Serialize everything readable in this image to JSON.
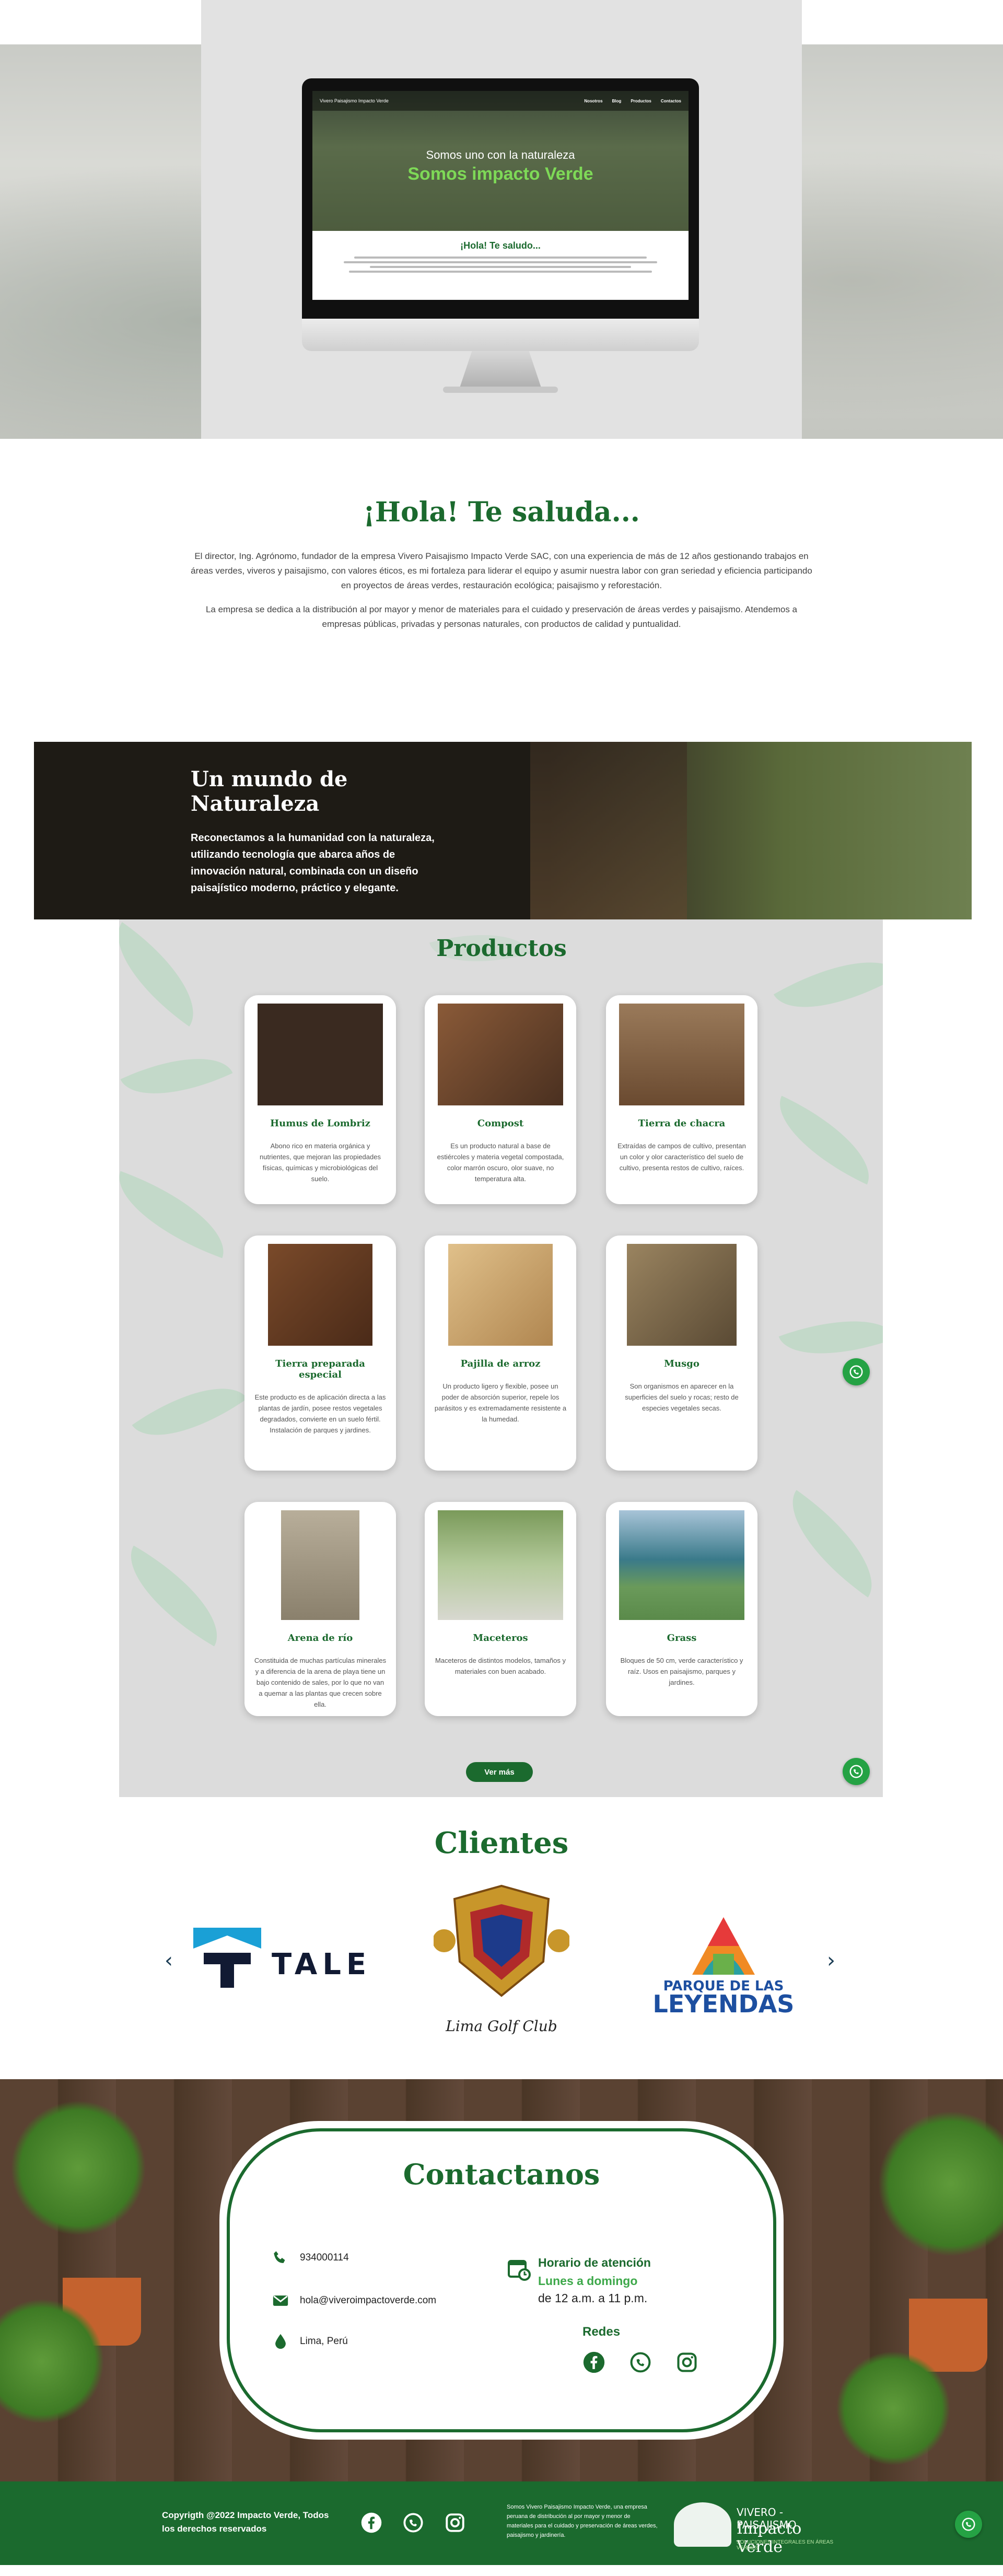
{
  "hero": {
    "nav": [
      "Nosotros",
      "Blog",
      "Productos",
      "Contactos"
    ],
    "logo_text": "Vivero Paisajismo Impacto Verde",
    "headline": "Somos uno con la naturaleza",
    "headline_accent": "Somos impacto Verde",
    "sub_title": "¡Hola! Te saludo..."
  },
  "intro": {
    "title": "¡Hola! Te saluda...",
    "paragraph1": "El director, Ing. Agrónomo, fundador de la empresa Vivero Paisajismo Impacto Verde SAC, con una experiencia de más de 12 años gestionando trabajos en áreas verdes, viveros y paisajismo, con valores éticos, es mi fortaleza para liderar el equipo y asumir nuestra labor con gran seriedad y eficiencia participando en proyectos de áreas verdes, restauración ecológica; paisajismo y reforestación.",
    "paragraph2": "La empresa se dedica a la distribución al por mayor y menor de materiales para el cuidado y preservación de áreas verdes y paisajismo. Atendemos a empresas públicas, privadas y personas naturales, con productos de calidad y puntualidad."
  },
  "mundo": {
    "title": "Un mundo de Naturaleza",
    "text": "Reconectamos a la humanidad con la naturaleza, utilizando tecnología que abarca años de innovación natural, combinada con un diseño paisajístico moderno, práctico y elegante."
  },
  "productos": {
    "title": "Productos",
    "items": [
      {
        "name": "Humus de Lombriz",
        "desc": "Abono rico en materia orgánica y nutrientes, que mejoran las propiedades físicas, químicas y microbiológicas del suelo.",
        "color": "#3a2a20"
      },
      {
        "name": "Compost",
        "desc": "Es un producto natural a base de estiércoles y materia vegetal compostada, color marrón oscuro, olor suave, no temperatura alta.",
        "color": "#6b4a30"
      },
      {
        "name": "Tierra de chacra",
        "desc": "Extraídas de campos de cultivo, presentan un color y olor característico del suelo de cultivo, presenta restos de cultivo, raíces.",
        "color": "#7a5a40"
      },
      {
        "name": "Tierra preparada especial",
        "desc": "Este producto es de aplicación directa a las plantas de jardín, posee restos vegetales degradados, convierte en un suelo fértil. Instalación de parques y jardines.",
        "color": "#5a3a22"
      },
      {
        "name": "Pajilla de arroz",
        "desc": "Un producto ligero y flexible, posee un poder de absorción superior, repele los parásitos y es extremadamente resistente a la humedad.",
        "color": "#c9a06a"
      },
      {
        "name": "Musgo",
        "desc": "Son organismos en aparecer en la superficies del suelo y rocas; resto de especies vegetales secas.",
        "color": "#7c6a4c"
      },
      {
        "name": "Arena de río",
        "desc": "Constituida de muchas partículas minerales y a diferencia de la arena de playa tiene un bajo contenido de sales, por lo que no van a quemar a las plantas que crecen sobre ella.",
        "color": "#a49a86"
      },
      {
        "name": "Maceteros",
        "desc": "Maceteros de distintos modelos, tamaños y materiales con buen acabado.",
        "color": "#7ea65a"
      },
      {
        "name": "Grass",
        "desc": "Bloques de 50 cm, verde característico y raíz. Usos en paisajismo, parques y jardines.",
        "color": "#6a8a70"
      }
    ],
    "button": "Ver más"
  },
  "clientes": {
    "title": "Clientes",
    "logos": {
      "tale": "TALE",
      "lima": "Lima Golf Club",
      "parque_line1": "PARQUE DE LAS",
      "parque_line2": "LEYENDAS"
    }
  },
  "contacto": {
    "title": "Contactanos",
    "phone": "934000114",
    "email": "hola@viveroimpactoverde.com",
    "location": "Lima, Perú",
    "horario_title": "Horario de atención",
    "horario_days": "Lunes a domingo",
    "horario_hours": "de 12 a.m. a 11 p.m.",
    "redes_title": "Redes"
  },
  "footer": {
    "copyright": "Copyrigth @2022 Impacto Verde, Todos los derechos reservados",
    "about": "Somos Vivero Paisajismo Impacto Verde, una empresa peruana de distribución al por mayor y menor de materiales para el cuidado y preservación de áreas verdes, paisajismo y jardinería.",
    "brand_line1": "VIVERO - PAISAJISMO",
    "brand_line2": "Impacto Verde",
    "brand_line3": "SOLUCIONES INTEGRALES EN ÁREAS VERDES"
  },
  "colors": {
    "brand_green": "#1b6a2e",
    "accent_green": "#3da84a",
    "whatsapp": "#25a244"
  }
}
